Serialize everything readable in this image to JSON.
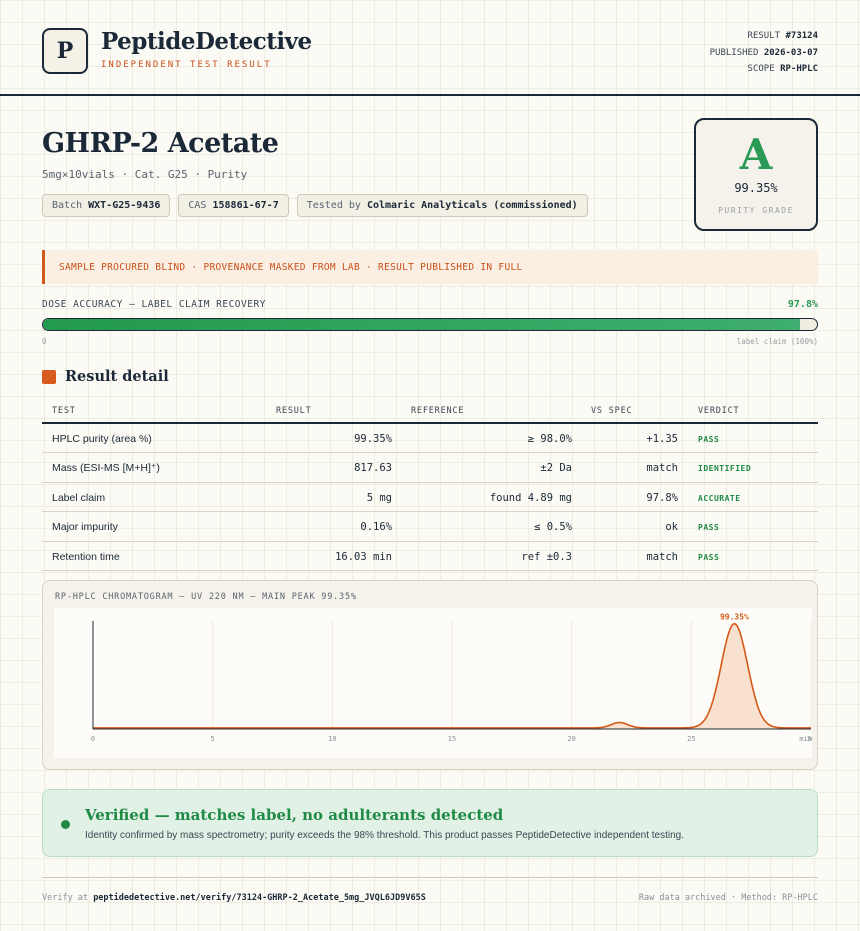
{
  "brand": {
    "logo_letter": "P",
    "name": "PeptideDetective",
    "tagline": "INDEPENDENT TEST RESULT"
  },
  "meta": {
    "result_label": "RESULT",
    "result_value": "#73124",
    "published_label": "PUBLISHED",
    "published_value": "2026-03-07",
    "scope_label": "SCOPE",
    "scope_value": "RP-HPLC"
  },
  "product": {
    "title": "GHRP-2 Acetate",
    "subtitle": "5mg×10vials · Cat. G25 · Purity",
    "chips": [
      {
        "label": "Batch",
        "value": "WXT-G25-9436"
      },
      {
        "label": "CAS",
        "value": "158861-67-7"
      },
      {
        "label": "Tested by",
        "value": "Colmaric Analyticals (commissioned)"
      }
    ]
  },
  "grade": {
    "letter": "A",
    "percent": "99.35%",
    "label": "PURITY GRADE"
  },
  "notice": "SAMPLE PROCURED BLIND · PROVENANCE MASKED FROM LAB · RESULT PUBLISHED IN FULL",
  "dose": {
    "label": "DOSE ACCURACY — LABEL CLAIM RECOVERY",
    "percent_text": "97.8%",
    "fill_percent": 97.8,
    "min_label": "0",
    "max_label": "label claim (100%)"
  },
  "result_detail": {
    "title": "Result detail",
    "headers": {
      "test": "TEST",
      "result": "RESULT",
      "reference": "REFERENCE",
      "vs_spec": "VS SPEC",
      "verdict": "VERDICT"
    },
    "rows": [
      {
        "test": "HPLC purity (area %)",
        "result": "99.35%",
        "reference": "≥ 98.0%",
        "vs_spec": "+1.35",
        "verdict": "PASS"
      },
      {
        "test": "Mass (ESI-MS [M+H]⁺)",
        "result": "817.63",
        "reference": "±2 Da",
        "vs_spec": "match",
        "verdict": "IDENTIFIED"
      },
      {
        "test": "Label claim",
        "result": "5 mg",
        "reference": "found 4.89 mg",
        "vs_spec": "97.8%",
        "verdict": "ACCURATE"
      },
      {
        "test": "Major impurity",
        "result": "0.16%",
        "reference": "≤ 0.5%",
        "vs_spec": "ok",
        "verdict": "PASS"
      },
      {
        "test": "Retention time",
        "result": "16.03 min",
        "reference": "ref ±0.3",
        "vs_spec": "match",
        "verdict": "PASS"
      }
    ]
  },
  "chromatogram": {
    "title": "RP-HPLC CHROMATOGRAM — UV 220 NM — MAIN PEAK 99.35%",
    "peak_label": "99.35%",
    "x_ticks": [
      "0",
      "5",
      "10",
      "15",
      "20",
      "25",
      "30"
    ],
    "x_unit": "min",
    "xlim": [
      0,
      30
    ],
    "ylim": [
      0,
      100
    ],
    "baseline": 1.0,
    "peaks": [
      {
        "center": 22.0,
        "height": 5.0,
        "width": 0.35
      },
      {
        "center": 26.8,
        "height": 96.5,
        "width": 0.55
      }
    ],
    "colors": {
      "line": "#d35a18",
      "fill": "#f8e1cf"
    }
  },
  "verified": {
    "title": "Verified — matches label, no adulterants detected",
    "text": "Identity confirmed by mass spectrometry; purity exceeds the 98% threshold. This product passes PeptideDetective independent testing."
  },
  "footer": {
    "verify_prefix": "Verify at",
    "verify_url": "peptidedetective.net/verify/73124-GHRP-2_Acetate_5mg_JVQL6JD9V65S",
    "right_text": "Raw data archived · Method: RP-HPLC"
  }
}
